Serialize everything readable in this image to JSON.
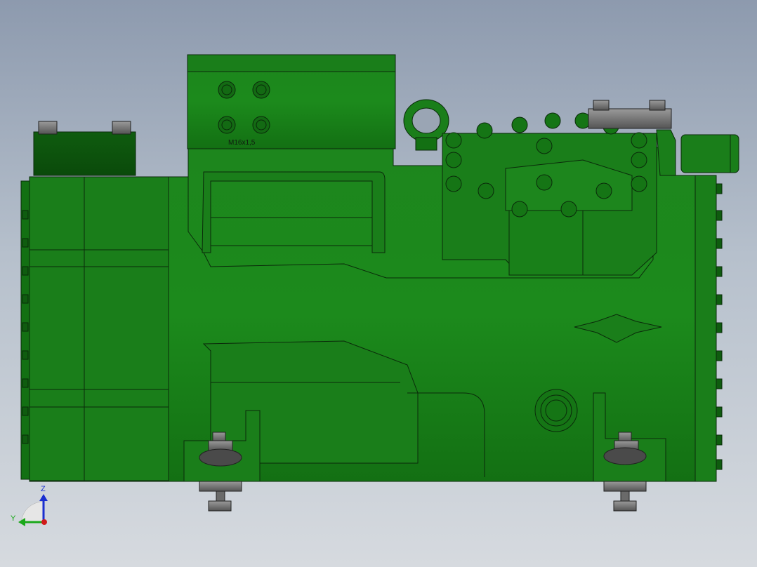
{
  "model": {
    "body_color": "#1f8a1f",
    "edge_color": "#0a2a0a",
    "hardware_color": "#707070"
  },
  "annotations": {
    "thread_label": "M16x1,5"
  },
  "triad": {
    "z_label": "Z",
    "y_label": "Y",
    "z_color": "#1a2fd0",
    "y_color": "#1aa81a",
    "origin_color": "#d01a1a"
  }
}
